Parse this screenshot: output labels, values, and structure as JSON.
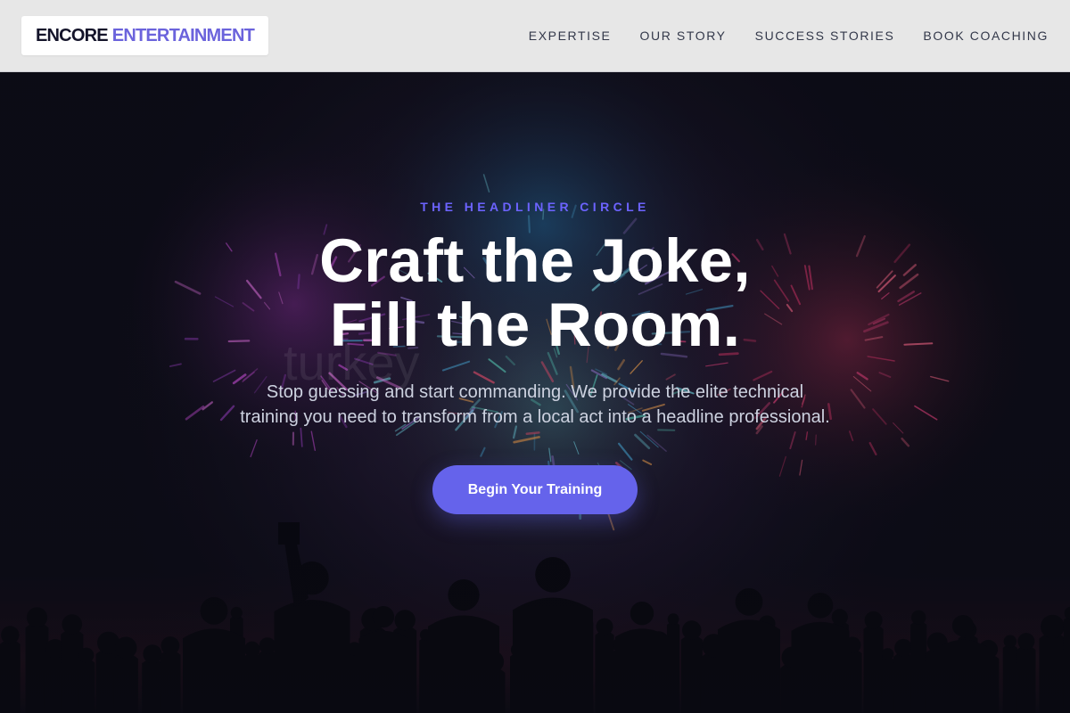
{
  "brand": {
    "word1": "ENCORE",
    "word2": "ENTERTAINMENT"
  },
  "nav": {
    "items": [
      {
        "label": "EXPERTISE"
      },
      {
        "label": "OUR STORY"
      },
      {
        "label": "SUCCESS STORIES"
      },
      {
        "label": "BOOK COACHING"
      }
    ]
  },
  "hero": {
    "eyebrow": "THE HEADLINER CIRCLE",
    "headline_line1": "Craft the Joke,",
    "headline_line2": "Fill the Room.",
    "subtitle_line1": "Stop guessing and start commanding. We provide the elite technical",
    "subtitle_line2": "training you need to transform from a local act into a headline professional.",
    "cta_label": "Begin Your Training",
    "watermark": "turkey"
  },
  "colors": {
    "accent": "#6563eb",
    "eyebrow": "#6c63ff",
    "nav_bg": "#e7e7e7",
    "hero_bg": "#0c0c16"
  },
  "icons": []
}
